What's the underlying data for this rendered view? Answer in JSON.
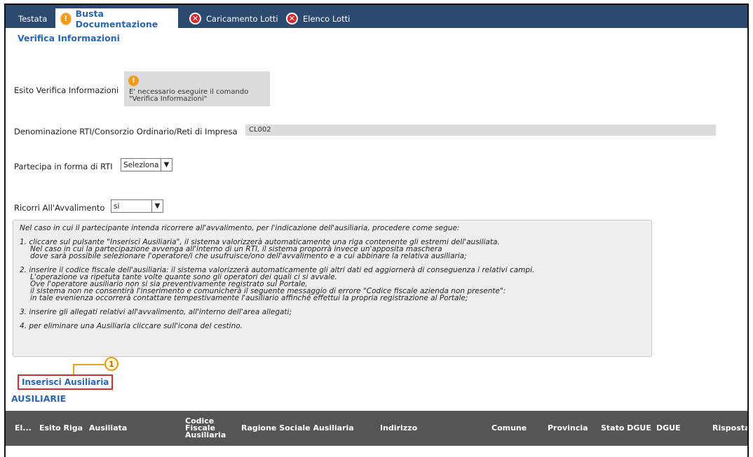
{
  "tabs": [
    {
      "label": "Testata",
      "icon": null
    },
    {
      "label": "Busta Documentazione",
      "icon": "warning-icon",
      "active": true
    },
    {
      "label": "Caricamento Lotti",
      "icon": "error-icon"
    },
    {
      "label": "Elenco Lotti",
      "icon": "error-icon"
    }
  ],
  "section_title": "Verifica Informazioni",
  "esito": {
    "label": "Esito Verifica Informazioni",
    "message_line1": "E' necessario eseguire il comando",
    "message_line2": "\"Verifica Informazioni\""
  },
  "denominazione": {
    "label": "Denominazione RTI/Consorzio Ordinario/Reti di Impresa",
    "value": "CL002"
  },
  "rti": {
    "label": "Partecipa in forma di RTI",
    "selected": "Seleziona"
  },
  "avvalimento": {
    "label": "Ricorri All'Avvalimento",
    "selected": "si"
  },
  "instructions": {
    "intro": "Nel caso in cui il partecipante intenda ricorrere all'avvalimento, per l'indicazione dell'ausiliaria, procedere come segue:",
    "steps": [
      [
        "1. cliccare sul pulsante \"Inserisci Ausiliaria\", il sistema valorizzerà automaticamente una riga contenente gli estremi dell'ausiliata.",
        "Nel caso in cui la partecipazione avvenga all'interno di un RTI, il sistema proporrà invece un'apposita maschera",
        "dove sarà possibile selezionare l'operatore/i che usufruisce/ono dell'avvalimento e a cui abbinare la relativa ausiliaria;"
      ],
      [
        "2. inserire il codice fiscale dell'ausiliaria: il sistema valorizzerà automaticamente gli altri dati ed aggiornerà di conseguenza i relativi campi.",
        "L'operazione va ripetuta tante volte quante sono gli operatori dei quali ci si avvale.",
        "Ove l'operatore ausiliario non si sia preventivamente registrato sul Portale,",
        "il sistema non ne consentirà l'inserimento e comunicherà il seguente messaggio di errore \"Codice fiscale azienda non presente\":",
        "in tale evenienza occorrerà contattare tempestivamente l'ausiliario affinché effettui la propria registrazione al Portale;"
      ],
      [
        "3. inserire gli allegati relativi all'avvalimento, all'interno dell'area allegati;"
      ],
      [
        "4. per eliminare una Ausiliaria cliccare sull'icona del cestino."
      ]
    ]
  },
  "callout_number": "1",
  "insert_link": "Inserisci Ausiliaria",
  "ausiliarie_title": "AUSILIARIE",
  "table": {
    "columns": [
      "El...",
      "Esito Riga",
      "Ausiliata",
      "Codice Fiscale Ausiliaria",
      "Ragione Sociale Ausiliaria",
      "Indirizzo",
      "Comune",
      "Provincia",
      "Stato DGUE",
      "DGUE",
      "Risposta"
    ]
  },
  "colors": {
    "tabbar": "#2b4a6f",
    "accent": "#2a66b3",
    "warning": "#f29a1a",
    "error": "#d9272e",
    "highlight": "#d32f2f",
    "table_header": "#555555"
  }
}
